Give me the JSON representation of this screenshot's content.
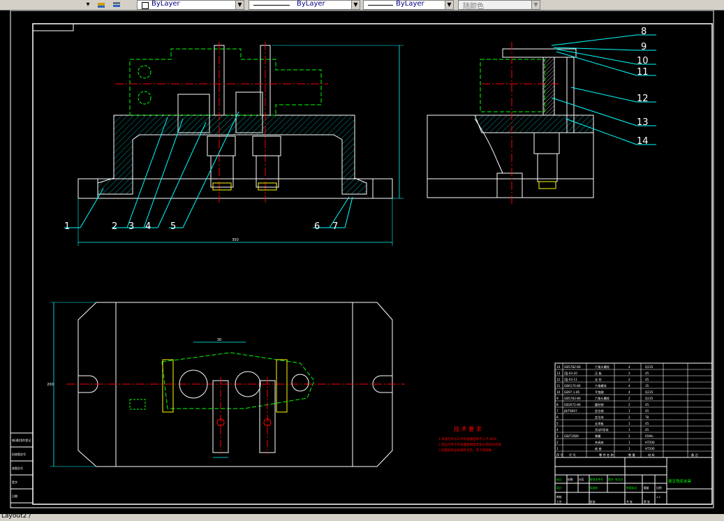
{
  "toolbar": {
    "color_combo": "ByLayer",
    "linetype_combo": "ByLayer",
    "lineweight_combo": "ByLayer",
    "plotstyle_combo": "随颜色"
  },
  "drawing": {
    "balloons": [
      "1",
      "2",
      "3",
      "4",
      "5",
      "6",
      "7",
      "8",
      "9",
      "10",
      "11",
      "12",
      "13",
      "14"
    ],
    "tech_title": "技 术 要 求",
    "tech_lines": [
      "1.夹紧元件与工件的接触面积不小于 80%",
      "2.定位元件工作表面粗糙度等加工后检验合格",
      "3.装配后各运动部件灵活，无卡滞现象"
    ],
    "bom": [
      [
        "14",
        "GB5782-86",
        "六角头螺栓",
        "4",
        "Q235",
        ""
      ],
      [
        "13",
        "ZJJ-03-20",
        "压 板",
        "2",
        "45",
        ""
      ],
      [
        "12",
        "ZJJ-03-11",
        "支 柱",
        "2",
        "45",
        ""
      ],
      [
        "11",
        "GB6170-86",
        "六角螺母",
        "4",
        "35",
        ""
      ],
      [
        "10",
        "GB97.1-85",
        "平垫圈",
        "4",
        "Q235",
        ""
      ],
      [
        "9",
        "GB5783-86",
        "六角头螺栓",
        "2",
        "Q235",
        ""
      ],
      [
        "8",
        "GB2672-86",
        "圆柱销",
        "2",
        "45",
        ""
      ],
      [
        "7",
        "JB/T8007",
        "定位销",
        "1",
        "45",
        ""
      ],
      [
        "6",
        "",
        "定位块",
        "2",
        "T8",
        ""
      ],
      [
        "5",
        "",
        "支承板",
        "1",
        "45",
        ""
      ],
      [
        "4",
        "",
        "活动V形块",
        "1",
        "45",
        ""
      ],
      [
        "3",
        "GB/T2089",
        "弹簧",
        "2",
        "65Mn",
        ""
      ],
      [
        "2",
        "",
        "夹具体",
        "1",
        "HT200",
        ""
      ],
      [
        "1",
        "",
        "底 座",
        "1",
        "HT200",
        ""
      ]
    ],
    "bom_header": [
      "序 号",
      "代 号",
      "零 件 名 称",
      "数 量",
      "材 料",
      "备 注"
    ],
    "title_block_name": "拨叉铣床夹具",
    "title_block_cells": [
      "标记",
      "处数",
      "分区",
      "更改文件号",
      "签名",
      "年月日",
      "设计",
      "标准化",
      "阶段标记",
      "重量",
      "比例",
      "审核",
      "工艺",
      "批准",
      "共 张",
      "第 张",
      "1:1"
    ],
    "left_labels": [
      "借(通)用件登记",
      "旧底图总号",
      "底图总号",
      "签字",
      "日期"
    ],
    "dim_width": "350",
    "dim_height": "200",
    "dim_small": "30"
  },
  "status": {
    "layout_tab": "Layout2 /"
  }
}
